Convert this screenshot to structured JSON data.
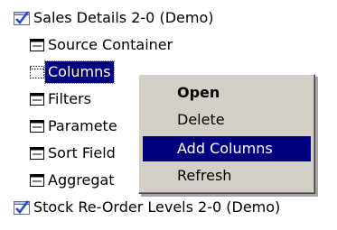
{
  "tree": {
    "root1": {
      "label": "Sales Details 2-0 (Demo)",
      "icon": "report-check-icon"
    },
    "children": [
      {
        "label": "Source Container",
        "icon": "container-node-icon"
      },
      {
        "label": "Columns",
        "icon": "columns-node-icon",
        "selected": true
      },
      {
        "label": "Filters",
        "icon": "container-node-icon"
      },
      {
        "label": "Paramete",
        "icon": "container-node-icon"
      },
      {
        "label": "Sort Field",
        "icon": "container-node-icon"
      },
      {
        "label": "Aggregat",
        "icon": "container-node-icon"
      }
    ],
    "root2": {
      "label": "Stock Re-Order Levels 2-0 (Demo)",
      "icon": "report-check-icon"
    }
  },
  "context_menu": {
    "items": [
      {
        "label": "Open",
        "default": true
      },
      {
        "label": "Delete"
      },
      {
        "label": "Add Columns",
        "highlighted": true
      },
      {
        "label": "Refresh"
      }
    ]
  },
  "colors": {
    "selection": "#000080",
    "menu_bg": "#d4d0c8",
    "check": "#1f4fd6"
  }
}
